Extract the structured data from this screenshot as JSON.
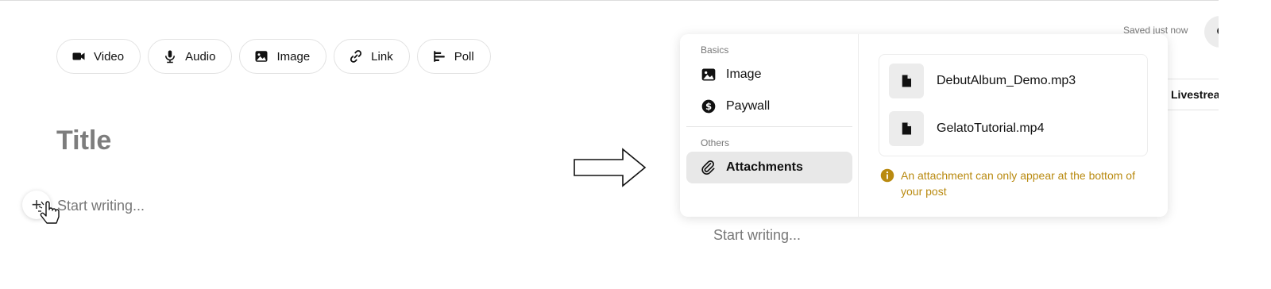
{
  "left_editor": {
    "toolbar": [
      {
        "label": "Video",
        "icon": "video-camera-icon"
      },
      {
        "label": "Audio",
        "icon": "microphone-icon"
      },
      {
        "label": "Image",
        "icon": "image-icon"
      },
      {
        "label": "Link",
        "icon": "link-icon"
      },
      {
        "label": "Poll",
        "icon": "poll-icon"
      }
    ],
    "title_placeholder": "Title",
    "body_placeholder": "Start writing...",
    "plus_symbol": "+"
  },
  "right_editor": {
    "saved_status": "Saved just now",
    "livestream_tab": "Livestrea",
    "body_placeholder": "Start writing...",
    "menu": {
      "sections": [
        {
          "label": "Basics",
          "items": [
            {
              "label": "Image",
              "icon": "image-icon"
            },
            {
              "label": "Paywall",
              "icon": "dollar-circle-icon"
            }
          ]
        },
        {
          "label": "Others",
          "items": [
            {
              "label": "Attachments",
              "icon": "paperclip-icon",
              "active": true
            }
          ]
        }
      ]
    },
    "attachments": [
      {
        "name": "DebutAlbum_Demo.mp3",
        "icon": "file-icon"
      },
      {
        "name": "GelatoTutorial.mp4",
        "icon": "file-icon"
      }
    ],
    "warning_text": "An attachment can only appear at the bottom of your post"
  },
  "colors": {
    "warning": "#b98a10",
    "active_menu_bg": "#e8e8e8",
    "placeholder": "#777777"
  }
}
